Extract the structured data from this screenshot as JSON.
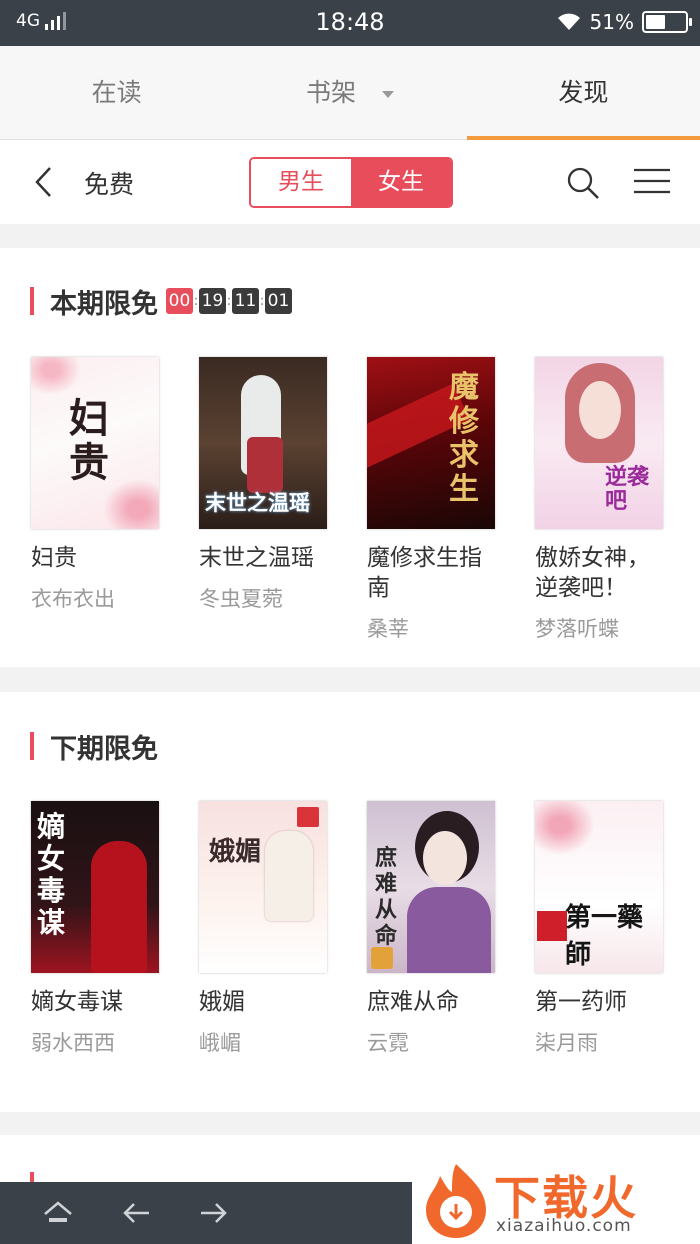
{
  "status": {
    "network": "4G",
    "time": "18:48",
    "battery": "51%",
    "battery_level": 0.51
  },
  "tabs": [
    {
      "label": "在读"
    },
    {
      "label": "书架"
    },
    {
      "label": "发现"
    }
  ],
  "subheader": {
    "title": "免费",
    "segment": [
      "男生",
      "女生"
    ]
  },
  "section_current": {
    "title": "本期限免",
    "countdown": [
      "00",
      "19",
      "11",
      "01"
    ],
    "books": [
      {
        "title": "妇贵",
        "author": "衣布衣出",
        "cover_title": "妇贵"
      },
      {
        "title": "末世之温瑶",
        "author": "冬虫夏菀",
        "cover_title": "末世之温瑶"
      },
      {
        "title": "魔修求生指南",
        "author": "桑莘",
        "cover_title": "魔修求生"
      },
      {
        "title": "傲娇女神，逆袭吧！",
        "author": "梦落听蝶",
        "cover_title": "逆袭吧"
      }
    ]
  },
  "section_next": {
    "title": "下期限免",
    "books": [
      {
        "title": "嫡女毒谋",
        "author": "弱水西西",
        "cover_title": "嫡女毒谋"
      },
      {
        "title": "娥媚",
        "author": "峨嵋",
        "cover_title": "娥媚"
      },
      {
        "title": "庶难从命",
        "author": "云霓",
        "cover_title": "庶难从命"
      },
      {
        "title": "第一药师",
        "author": "柒月雨",
        "cover_title": "第一藥師"
      }
    ]
  },
  "watermark": {
    "text": "下载火",
    "url": "xiazaihuo.com"
  },
  "colors": {
    "accent": "#e84d5b",
    "tab_indicator": "#f39a3c",
    "statusbar": "#3b4148"
  }
}
